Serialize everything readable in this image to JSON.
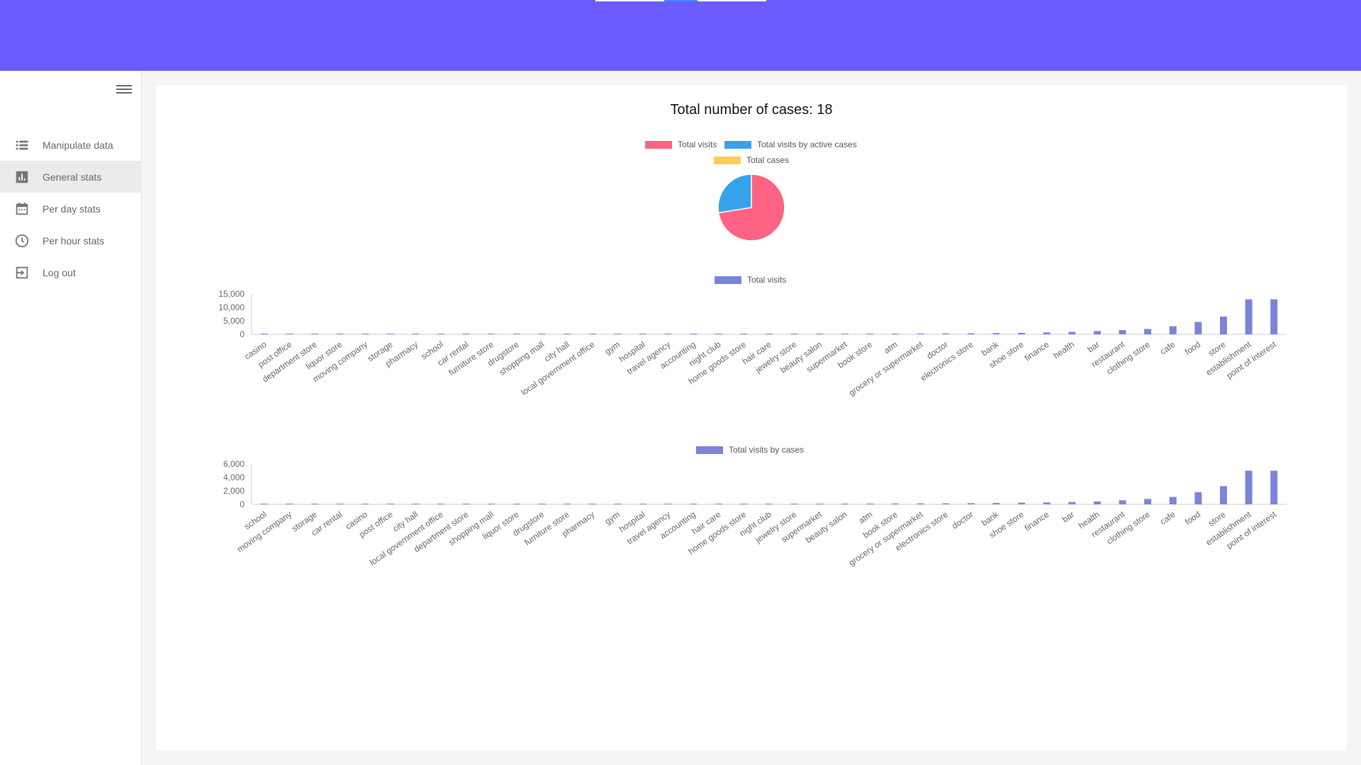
{
  "appbar": {
    "color": "#6a5cff"
  },
  "sidebar": {
    "menu_icon": "hamburger-icon",
    "items": [
      {
        "label": "Manipulate data",
        "icon": "list-icon",
        "active": false
      },
      {
        "label": "General stats",
        "icon": "bar-chart-icon",
        "active": true
      },
      {
        "label": "Per day stats",
        "icon": "calendar-icon",
        "active": false
      },
      {
        "label": "Per hour stats",
        "icon": "clock-icon",
        "active": false
      },
      {
        "label": "Log out",
        "icon": "logout-icon",
        "active": false
      }
    ]
  },
  "main": {
    "title": "Total number of cases: 18"
  },
  "chart_data": [
    {
      "type": "pie",
      "title": "",
      "legend": [
        {
          "name": "Total visits",
          "color": "#ff6384"
        },
        {
          "name": "Total visits by active cases",
          "color": "#36a2eb"
        },
        {
          "name": "Total cases",
          "color": "#ffce56"
        }
      ],
      "values": [
        72.5,
        27.5,
        0
      ],
      "legend_position": "top"
    },
    {
      "type": "bar",
      "series": [
        {
          "name": "Total visits",
          "color": "#7b84d8",
          "values": [
            60,
            60,
            60,
            65,
            65,
            70,
            75,
            80,
            85,
            90,
            90,
            95,
            100,
            110,
            120,
            130,
            140,
            150,
            160,
            170,
            180,
            190,
            200,
            210,
            220,
            230,
            250,
            280,
            320,
            380,
            450,
            560,
            700,
            900,
            1200,
            1600,
            2000,
            3000,
            4600,
            6600,
            13000,
            13000
          ]
        }
      ],
      "categories": [
        "casino",
        "post office",
        "department store",
        "liquor store",
        "moving company",
        "storage",
        "pharmacy",
        "school",
        "car rental",
        "furniture store",
        "drugstore",
        "shopping mall",
        "city hall",
        "local government office",
        "gym",
        "hospital",
        "travel agency",
        "accounting",
        "night club",
        "home goods store",
        "hair care",
        "jewelry store",
        "beauty salon",
        "supermarket",
        "book store",
        "atm",
        "grocery or supermarket",
        "doctor",
        "electronics store",
        "bank",
        "shoe store",
        "finance",
        "health",
        "bar",
        "restaurant",
        "clothing store",
        "cafe",
        "food",
        "store",
        "establishment",
        "point of interest"
      ],
      "yticks": [
        "15,000",
        "10,000",
        "5,000",
        "0"
      ],
      "ylim": [
        0,
        15000
      ],
      "legend_position": "top"
    },
    {
      "type": "bar",
      "series": [
        {
          "name": "Total visits by cases",
          "color": "#7b84d8",
          "values": [
            20,
            20,
            20,
            20,
            25,
            25,
            25,
            30,
            30,
            35,
            35,
            40,
            40,
            45,
            50,
            55,
            60,
            65,
            70,
            75,
            80,
            85,
            90,
            95,
            100,
            110,
            120,
            130,
            140,
            150,
            170,
            200,
            240,
            280,
            340,
            420,
            600,
            800,
            1100,
            1800,
            2700,
            5000,
            5000
          ]
        }
      ],
      "categories": [
        "school",
        "moving company",
        "storage",
        "car rental",
        "casino",
        "post office",
        "city hall",
        "local government office",
        "department store",
        "shopping mall",
        "liquor store",
        "drugstore",
        "furniture store",
        "pharmacy",
        "gym",
        "hospital",
        "travel agency",
        "accounting",
        "hair care",
        "home goods store",
        "night club",
        "jewelry store",
        "supermarket",
        "beauty salon",
        "atm",
        "book store",
        "grocery or supermarket",
        "electronics store",
        "doctor",
        "bank",
        "shoe store",
        "finance",
        "bar",
        "health",
        "restaurant",
        "clothing store",
        "cafe",
        "food",
        "store",
        "establishment",
        "point of interest"
      ],
      "yticks": [
        "6,000",
        "4,000",
        "2,000",
        "0"
      ],
      "ylim": [
        0,
        6000
      ],
      "legend_position": "top"
    }
  ]
}
